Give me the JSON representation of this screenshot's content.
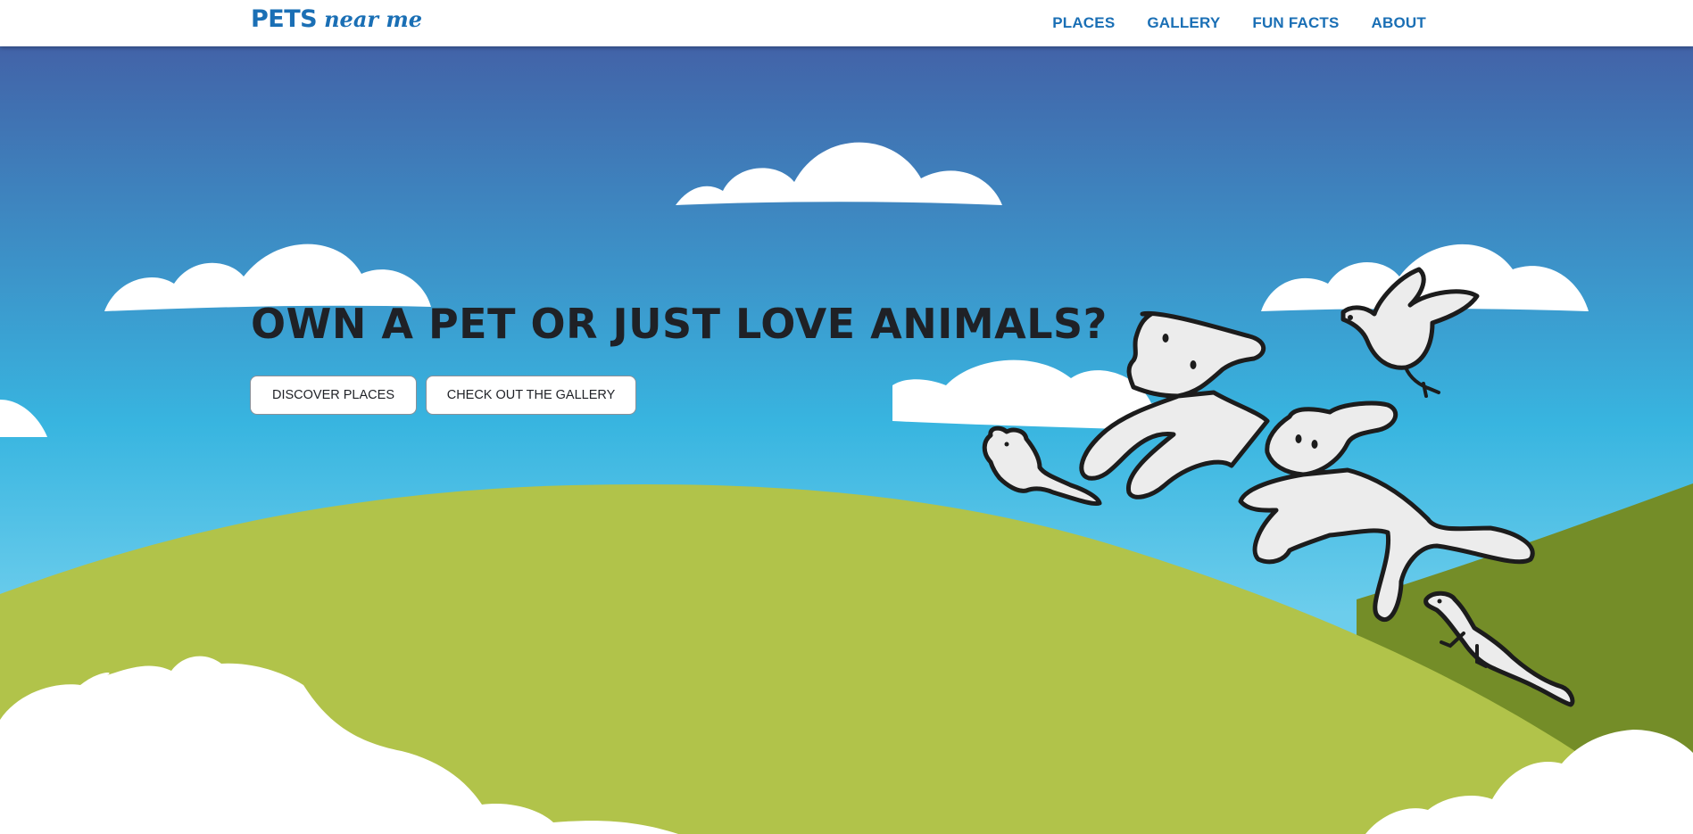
{
  "brand": {
    "main": "PETS",
    "script": "near me"
  },
  "nav": {
    "items": [
      {
        "label": "PLACES"
      },
      {
        "label": "GALLERY"
      },
      {
        "label": "FUN FACTS"
      },
      {
        "label": "ABOUT"
      }
    ]
  },
  "hero": {
    "title": "OWN A PET OR JUST LOVE ANIMALS?",
    "buttons": [
      {
        "label": "DISCOVER PLACES"
      },
      {
        "label": "CHECK OUT THE GALLERY"
      }
    ]
  },
  "colors": {
    "brand": "#1a6fb5",
    "sky_top": "#4263a8",
    "sky_mid": "#38b5e0",
    "sky_bottom": "#6ccdec",
    "hill": "#b1c34a",
    "hill_dark": "#748d28",
    "cloud": "#ffffff",
    "creature_fill": "#ececec",
    "creature_stroke": "#1c1c1c"
  },
  "icons": [
    "cloud-icon",
    "rabbit-icon",
    "bird-icon",
    "mouse-icon",
    "lizard-icon"
  ]
}
